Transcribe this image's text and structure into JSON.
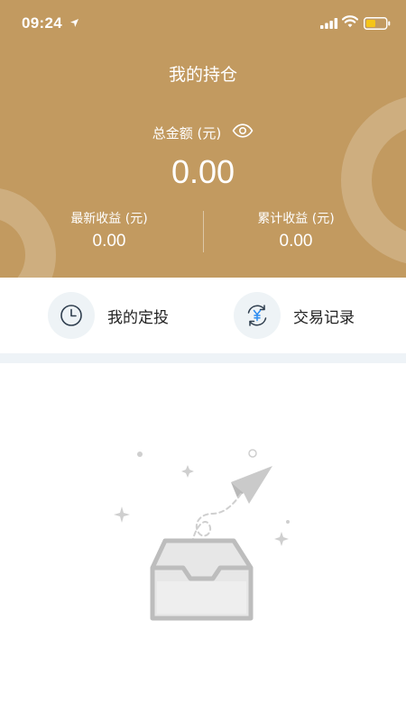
{
  "status_bar": {
    "time": "09:24"
  },
  "header": {
    "title": "我的持仓",
    "total_label": "总金额 (元)",
    "total_amount": "0.00",
    "latest_income_label": "最新收益 (元)",
    "latest_income_value": "0.00",
    "cumulative_income_label": "累计收益 (元)",
    "cumulative_income_value": "0.00"
  },
  "actions": [
    {
      "label": "我的定投",
      "icon": "clock-icon"
    },
    {
      "label": "交易记录",
      "icon": "yuan-exchange-icon"
    }
  ],
  "empty_state": {
    "illustration": "empty-inbox-paper-plane"
  },
  "colors": {
    "header_bg": "#c29a60",
    "action_icon_bg": "#eef3f6",
    "separator": "#eef3f7",
    "battery_fill": "#f5c518"
  }
}
